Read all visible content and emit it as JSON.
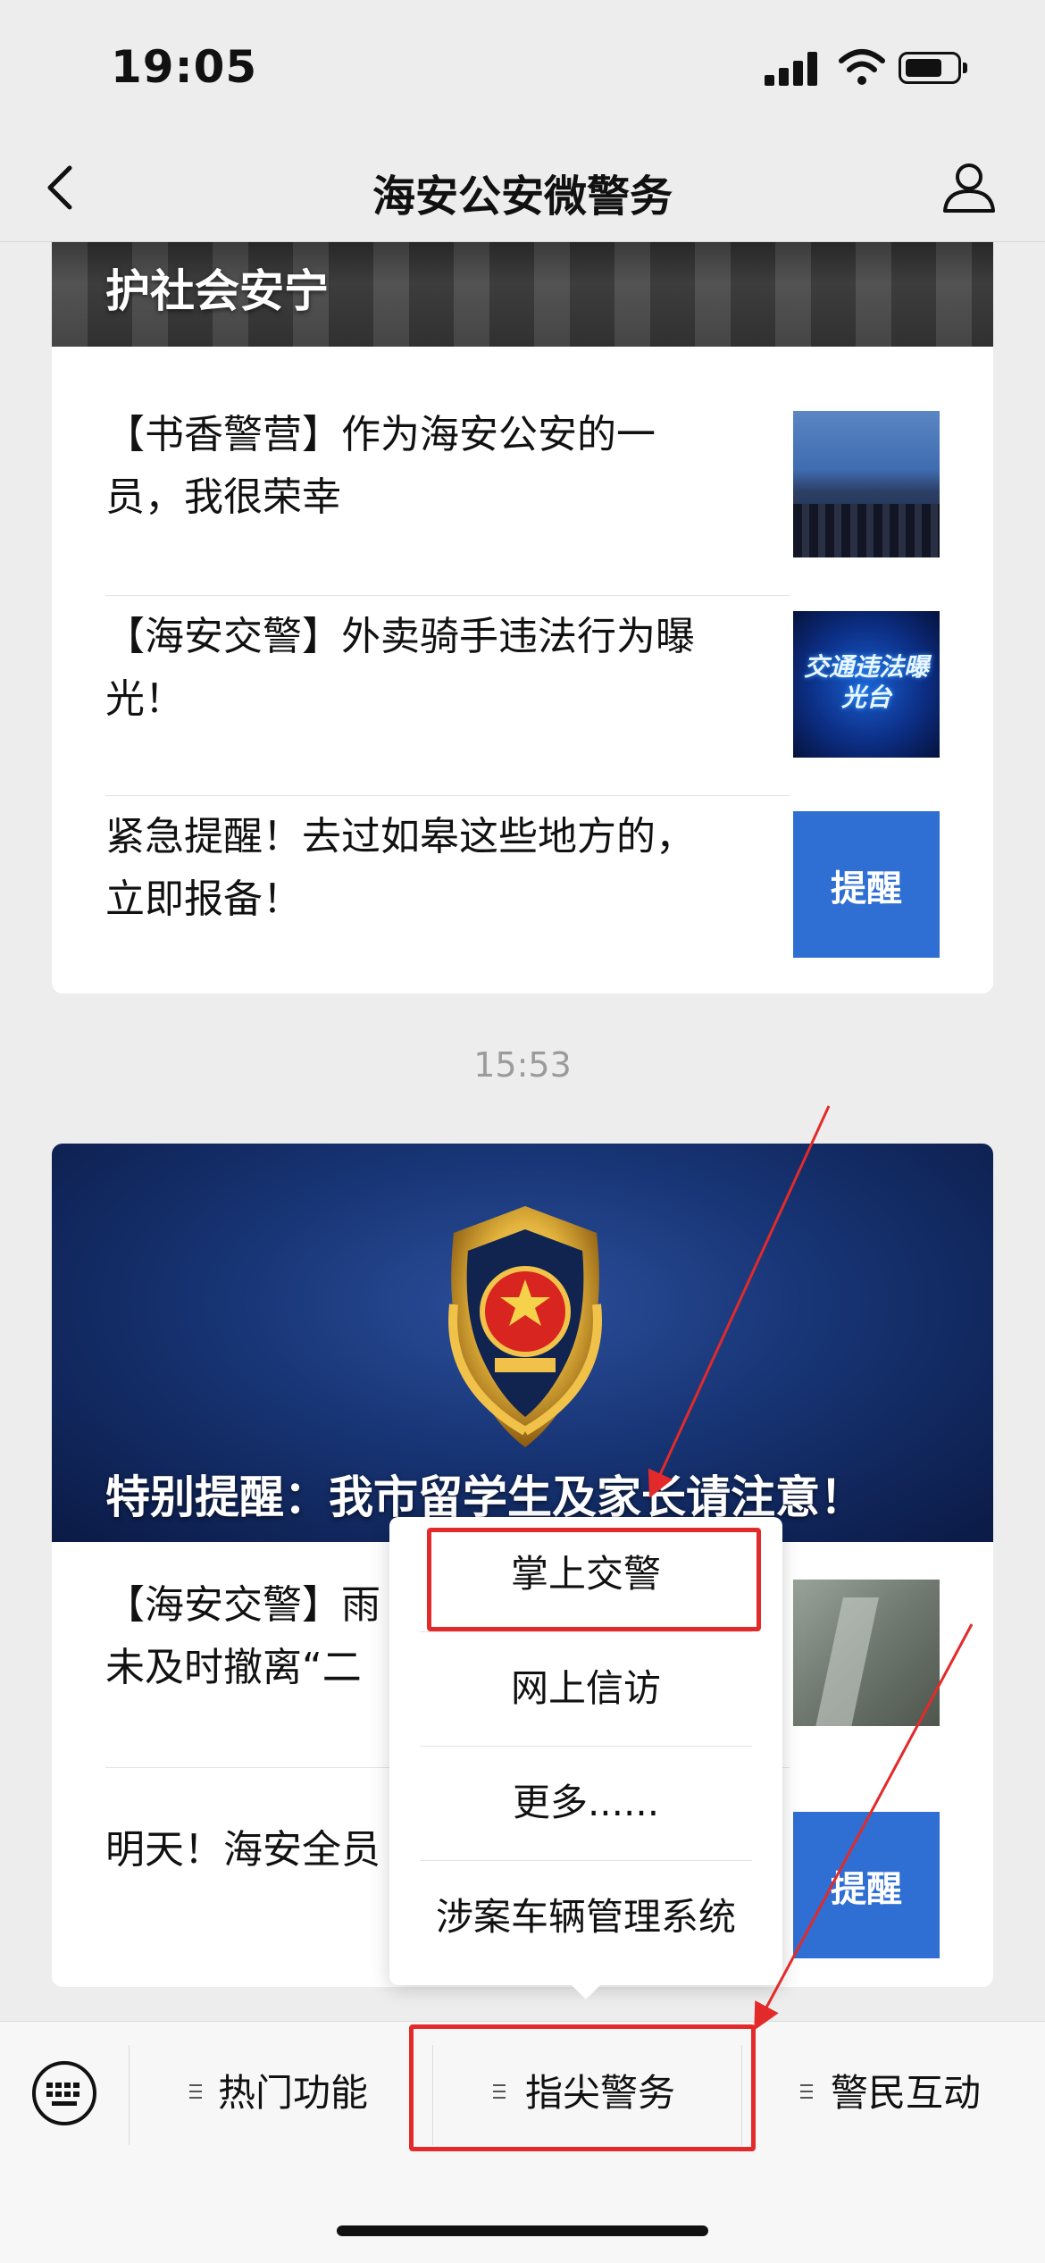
{
  "status_bar": {
    "time": "19:05"
  },
  "nav": {
    "title": "海安公安微警务"
  },
  "card1": {
    "cover_title": "护社会安宁",
    "items": [
      {
        "text": "【书香警营】作为海安公安的一员，我很荣幸"
      },
      {
        "text": "【海安交警】外卖骑手违法行为曝光！",
        "thumb_text": "交通违法曝光台"
      },
      {
        "text": "紧急提醒！去过如皋这些地方的，立即报备！",
        "thumb_text": "提醒"
      }
    ]
  },
  "timestamp": "15:53",
  "card2": {
    "cover_title": "特别提醒：我市留学生及家长请注意！",
    "items": [
      {
        "text": "【海安交警】雨\n未及时撤离“二"
      },
      {
        "text": "明天！海安全员",
        "thumb_text": "提醒"
      }
    ]
  },
  "popup_menu": {
    "items": [
      "掌上交警",
      "网上信访",
      "更多......",
      "涉案车辆管理系统"
    ],
    "highlighted": "掌上交警"
  },
  "bottom_menu": {
    "tabs": [
      "热门功能",
      "指尖警务",
      "警民互动"
    ],
    "highlighted": "指尖警务"
  },
  "colors": {
    "highlight": "#e32a2a",
    "background": "#ededed"
  }
}
